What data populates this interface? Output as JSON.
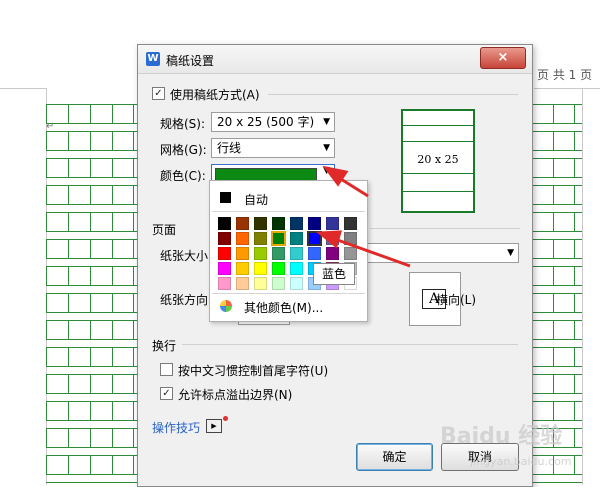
{
  "document": {
    "page_info": "页 共 1 页"
  },
  "dialog": {
    "title": "稿纸设置",
    "close_label": "×",
    "use_paper_mode": "使用稿纸方式(A)",
    "spec_label": "规格(S):",
    "spec_value": "20 x 25 (500 字)",
    "grid_label": "网格(G):",
    "grid_value": "行线",
    "color_label": "颜色(C):",
    "color_value": "#0c8a14",
    "preview_text": "20 x 25",
    "page_section": "页面",
    "paper_size_label": "纸张大小",
    "paper_dir_label": "纸张方向",
    "landscape_label": "横向(L)",
    "landscape_glyph": "A",
    "wrap_section": "换行",
    "chinese_ctrl": "按中文习惯控制首尾字符(U)",
    "allow_punct": "允许标点溢出边界(N)",
    "tips_label": "操作技巧",
    "ok_label": "确定",
    "cancel_label": "取消"
  },
  "palette": {
    "auto_label": "自动",
    "more_colors": "其他颜色(M)...",
    "tooltip": "蓝色",
    "rows": [
      [
        "#000000",
        "#993300",
        "#333300",
        "#003300",
        "#003366",
        "#000080",
        "#333399",
        "#333333"
      ],
      [
        "#800000",
        "#ff6600",
        "#808000",
        "#008000",
        "#008080",
        "#0000ff",
        "#666699",
        "#808080"
      ],
      [
        "#ff0000",
        "#ff9900",
        "#99cc00",
        "#339966",
        "#33cccc",
        "#3366ff",
        "#800080",
        "#969696"
      ],
      [
        "#ff00ff",
        "#ffcc00",
        "#ffff00",
        "#00ff00",
        "#00ffff",
        "#00ccff",
        "#993366",
        "#c0c0c0"
      ],
      [
        "#ff99cc",
        "#ffcc99",
        "#ffff99",
        "#ccffcc",
        "#ccffff",
        "#99ccff",
        "#cc99ff",
        "#ffffff"
      ]
    ]
  },
  "accent_green": "#1b7a2a",
  "watermark": "Baidu 经验",
  "watermark_url": "jingyan.baidu.com"
}
